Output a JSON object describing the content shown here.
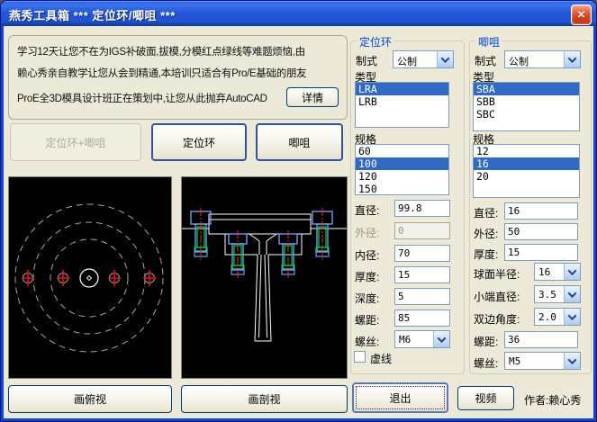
{
  "window": {
    "title": "燕秀工具箱      ***  定位环/唧咀  ***"
  },
  "icons": {
    "close": "×",
    "chevron": "chevron-down"
  },
  "colors": {
    "dialog_bg": "#ECE9D8",
    "group_label": "#0046D5",
    "list_highlight": "#316AC5",
    "cad_white": "#FFFFFF",
    "cad_red": "#FF2020",
    "cad_green": "#00C832",
    "cad_blue": "#6E9EEA"
  },
  "promo": {
    "lines": [
      "学习12天让您不在为IGS补破面,拔模,分模红点绿线等难题烦恼,由",
      "赖心秀亲自教学让您从会到精通,本培训只适合有Pro/E基础的朋友",
      "ProE全3D模具设计班正在策划中,让您从此抛弃AutoCAD"
    ],
    "detail_button": "详情"
  },
  "mode_buttons": {
    "combined": "定位环+唧咀",
    "ring": "定位环",
    "nozzle": "唧咀"
  },
  "ring": {
    "title": "定位环",
    "standard": {
      "label": "制式",
      "value": "公制"
    },
    "type": {
      "label": "类型",
      "options": [
        "LRA",
        "LRB"
      ],
      "selected": "LRA"
    },
    "spec": {
      "label": "规格",
      "options": [
        "60",
        "100",
        "120",
        "150"
      ],
      "selected": "100"
    },
    "rows": [
      {
        "label": "直径:",
        "value": "99.8"
      },
      {
        "label": "外径:",
        "value": "0"
      },
      {
        "label": "内径:",
        "value": "70"
      },
      {
        "label": "厚度:",
        "value": "15"
      },
      {
        "label": "深度:",
        "value": "5"
      },
      {
        "label": "螺距:",
        "value": "85"
      },
      {
        "label": "螺丝:",
        "value": "M6"
      }
    ],
    "dashed_checkbox": "虚线"
  },
  "nozzle": {
    "title": "唧咀",
    "standard": {
      "label": "制式",
      "value": "公制"
    },
    "type": {
      "label": "类型",
      "options": [
        "SBA",
        "SBB",
        "SBC"
      ],
      "selected": "SBA"
    },
    "spec": {
      "label": "规格",
      "options": [
        "12",
        "16",
        "20"
      ],
      "selected": "16"
    },
    "rows": [
      {
        "label": "直径:",
        "value": "16"
      },
      {
        "label": "外径:",
        "value": "50"
      },
      {
        "label": "厚度:",
        "value": "15"
      },
      {
        "label": "球面半径:",
        "value": "16"
      },
      {
        "label": "小端直径:",
        "value": "3.5"
      },
      {
        "label": "双边角度:",
        "value": "2.0"
      },
      {
        "label": "螺距:",
        "value": "36"
      },
      {
        "label": "螺丝:",
        "value": "M5"
      }
    ]
  },
  "bottom": {
    "draw_top": "画俯视",
    "draw_section": "画剖视",
    "exit": "退出",
    "video": "视频",
    "author": "作者:赖心秀"
  }
}
